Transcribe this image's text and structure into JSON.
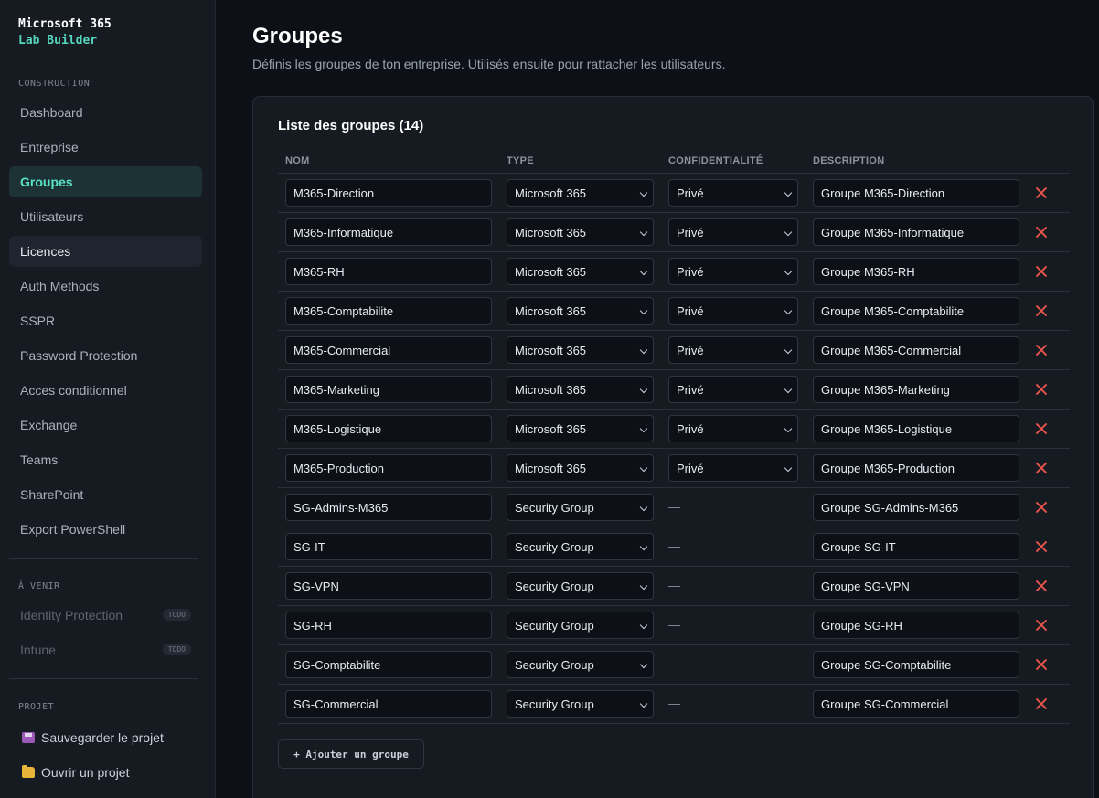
{
  "brand": {
    "line1": "Microsoft 365",
    "line2": "Lab Builder"
  },
  "sidebar": {
    "construction_label": "CONSTRUCTION",
    "nav": [
      {
        "label": "Dashboard"
      },
      {
        "label": "Entreprise"
      },
      {
        "label": "Groupes",
        "active": true
      },
      {
        "label": "Utilisateurs"
      },
      {
        "label": "Licences"
      },
      {
        "label": "Auth Methods"
      },
      {
        "label": "SSPR"
      },
      {
        "label": "Password Protection"
      },
      {
        "label": "Acces conditionnel"
      },
      {
        "label": "Exchange"
      },
      {
        "label": "Teams"
      },
      {
        "label": "SharePoint"
      },
      {
        "label": "Export PowerShell"
      }
    ],
    "upcoming_label": "À VENIR",
    "upcoming": [
      {
        "label": "Identity Protection",
        "badge": "TODO"
      },
      {
        "label": "Intune",
        "badge": "TODO"
      }
    ],
    "project_label": "PROJET",
    "project": [
      {
        "label": "Sauvegarder le projet",
        "icon": "floppy-disk-icon"
      },
      {
        "label": "Ouvrir un projet",
        "icon": "folder-icon"
      }
    ]
  },
  "header": {
    "title": "Groupes",
    "subtitle": "Définis les groupes de ton entreprise. Utilisés ensuite pour rattacher les utilisateurs."
  },
  "card": {
    "title": "Liste des groupes (14)",
    "columns": {
      "name": "NOM",
      "type": "TYPE",
      "privacy": "CONFIDENTIALITÉ",
      "description": "DESCRIPTION"
    },
    "empty_privacy": "—",
    "add_label": "+ Ajouter un groupe",
    "colors": {
      "accent": "#5be3c6",
      "delete": "#e5534b"
    }
  },
  "groups": [
    {
      "name": "M365-Direction",
      "type": "Microsoft 365",
      "privacy": "Privé",
      "description": "Groupe M365-Direction"
    },
    {
      "name": "M365-Informatique",
      "type": "Microsoft 365",
      "privacy": "Privé",
      "description": "Groupe M365-Informatique"
    },
    {
      "name": "M365-RH",
      "type": "Microsoft 365",
      "privacy": "Privé",
      "description": "Groupe M365-RH"
    },
    {
      "name": "M365-Comptabilite",
      "type": "Microsoft 365",
      "privacy": "Privé",
      "description": "Groupe M365-Comptabilite"
    },
    {
      "name": "M365-Commercial",
      "type": "Microsoft 365",
      "privacy": "Privé",
      "description": "Groupe M365-Commercial"
    },
    {
      "name": "M365-Marketing",
      "type": "Microsoft 365",
      "privacy": "Privé",
      "description": "Groupe M365-Marketing"
    },
    {
      "name": "M365-Logistique",
      "type": "Microsoft 365",
      "privacy": "Privé",
      "description": "Groupe M365-Logistique"
    },
    {
      "name": "M365-Production",
      "type": "Microsoft 365",
      "privacy": "Privé",
      "description": "Groupe M365-Production"
    },
    {
      "name": "SG-Admins-M365",
      "type": "Security Group",
      "privacy": null,
      "description": "Groupe SG-Admins-M365"
    },
    {
      "name": "SG-IT",
      "type": "Security Group",
      "privacy": null,
      "description": "Groupe SG-IT"
    },
    {
      "name": "SG-VPN",
      "type": "Security Group",
      "privacy": null,
      "description": "Groupe SG-VPN"
    },
    {
      "name": "SG-RH",
      "type": "Security Group",
      "privacy": null,
      "description": "Groupe SG-RH"
    },
    {
      "name": "SG-Comptabilite",
      "type": "Security Group",
      "privacy": null,
      "description": "Groupe SG-Comptabilite"
    },
    {
      "name": "SG-Commercial",
      "type": "Security Group",
      "privacy": null,
      "description": "Groupe SG-Commercial"
    }
  ]
}
